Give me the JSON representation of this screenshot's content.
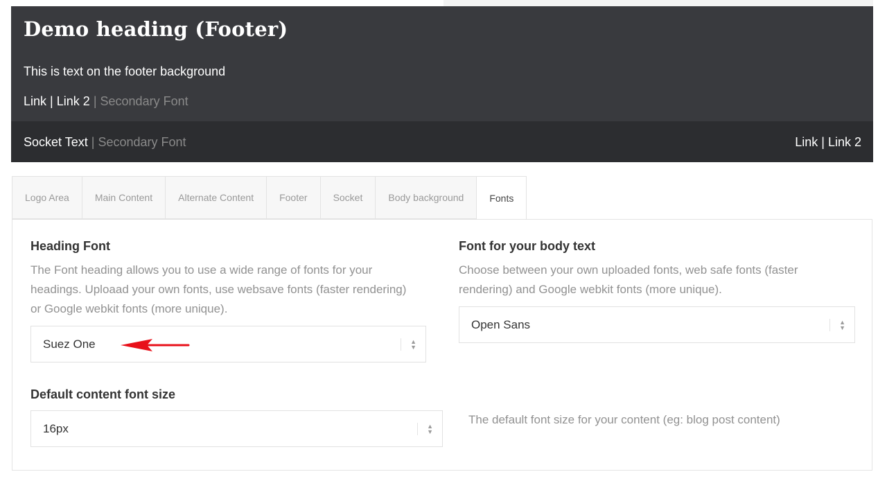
{
  "footer_preview": {
    "heading": "Demo heading (Footer)",
    "text": "This is text on the footer background",
    "link1": "Link",
    "sep1": "|",
    "link2": "Link 2",
    "sep2": "|",
    "secondary": "Secondary Font"
  },
  "socket": {
    "text": "Socket Text",
    "sep": "|",
    "secondary": "Secondary Font",
    "link1": "Link",
    "link_sep": "|",
    "link2": "Link 2"
  },
  "tabs": [
    {
      "label": "Logo Area"
    },
    {
      "label": "Main Content"
    },
    {
      "label": "Alternate Content"
    },
    {
      "label": "Footer"
    },
    {
      "label": "Socket"
    },
    {
      "label": "Body background"
    },
    {
      "label": "Fonts",
      "active": true
    }
  ],
  "heading_font": {
    "label": "Heading Font",
    "description": "The Font heading allows you to use a wide range of fonts for your headings. Uploaad your own fonts, use websave fonts (faster rendering) or Google webkit fonts (more unique).",
    "value": "Suez One"
  },
  "body_font": {
    "label": "Font for your body text",
    "description": "Choose between your own uploaded fonts, web safe fonts (faster rendering) and Google webkit fonts (more unique).",
    "value": "Open Sans"
  },
  "content_font_size": {
    "label": "Default content font size",
    "value": "16px",
    "description": "The default font size for your content (eg: blog post content)"
  },
  "colors": {
    "footer_bg": "#393a3e",
    "socket_bg": "#2c2d30",
    "annotation_arrow": "#e8101a"
  },
  "icons": [
    "select-arrows-icon",
    "red-arrow-annotation"
  ]
}
